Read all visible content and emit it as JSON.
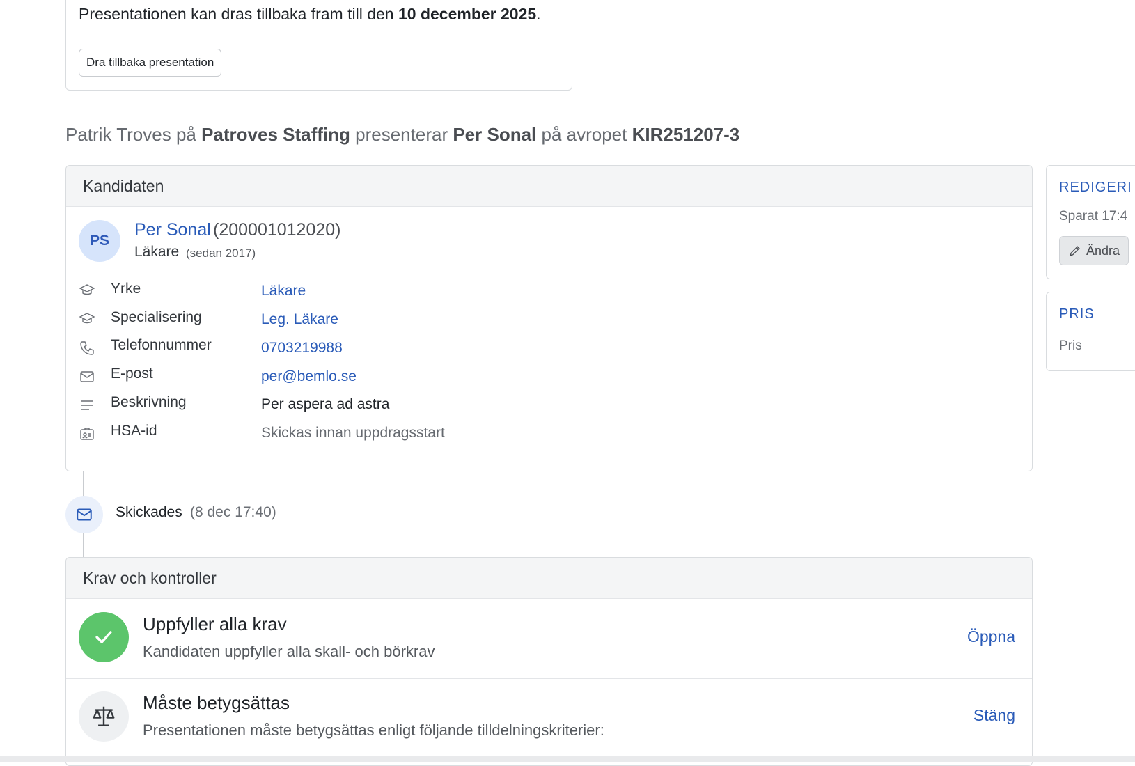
{
  "withdraw": {
    "text_prefix": "Presentationen kan dras tillbaka fram till den ",
    "date": "10 december 2025",
    "text_suffix": ".",
    "button_label": "Dra tillbaka presentation"
  },
  "headline": {
    "person": "Patrik Troves",
    "p1": " på ",
    "company": "Patroves Staffing",
    "p2": " presenterar ",
    "candidate": "Per Sonal",
    "p3": " på avropet ",
    "order_id": "KIR251207-3"
  },
  "candidate_card": {
    "header": "Kandidaten",
    "avatar_initials": "PS",
    "name": "Per Sonal",
    "personal_number": "(200001012020)",
    "role": "Läkare",
    "since": "(sedan 2017)",
    "rows": [
      {
        "icon": "graduation-cap-icon",
        "label": "Yrke",
        "value": "Läkare",
        "style": "link"
      },
      {
        "icon": "graduation-cap-icon",
        "label": "Specialisering",
        "value": "Leg. Läkare",
        "style": "link"
      },
      {
        "icon": "phone-icon",
        "label": "Telefonnummer",
        "value": "0703219988",
        "style": "link"
      },
      {
        "icon": "mail-icon",
        "label": "E-post",
        "value": "per@bemlo.se",
        "style": "link"
      },
      {
        "icon": "text-lines-icon",
        "label": "Beskrivning",
        "value": "Per aspera ad astra",
        "style": "plain"
      },
      {
        "icon": "id-card-icon",
        "label": "HSA-id",
        "value": "Skickas innan uppdragsstart",
        "style": "muted"
      }
    ]
  },
  "timeline": {
    "sent_label": "Skickades",
    "sent_time": "(8 dec 17:40)"
  },
  "requirements_card": {
    "header": "Krav och kontroller",
    "items": [
      {
        "icon": "check-icon",
        "title": "Uppfyller alla krav",
        "subtitle": "Kandidaten uppfyller alla skall- och börkrav",
        "action": "Öppna",
        "color": "#5cc56b"
      },
      {
        "icon": "scale-icon",
        "title": "Måste betygsättas",
        "subtitle": "Presentationen måste betygsättas enligt följande tilldelningskriterier:",
        "action": "Stäng"
      }
    ]
  },
  "sidebar": {
    "editing_title": "REDIGERI",
    "editing_saved": "Sparat 17:4",
    "edit_button": "Ändra",
    "price_title": "PRIS",
    "price_label": "Pris"
  },
  "colors": {
    "accent": "#2a5bb8",
    "success": "#5cc56b",
    "border": "#d9dcdf"
  }
}
